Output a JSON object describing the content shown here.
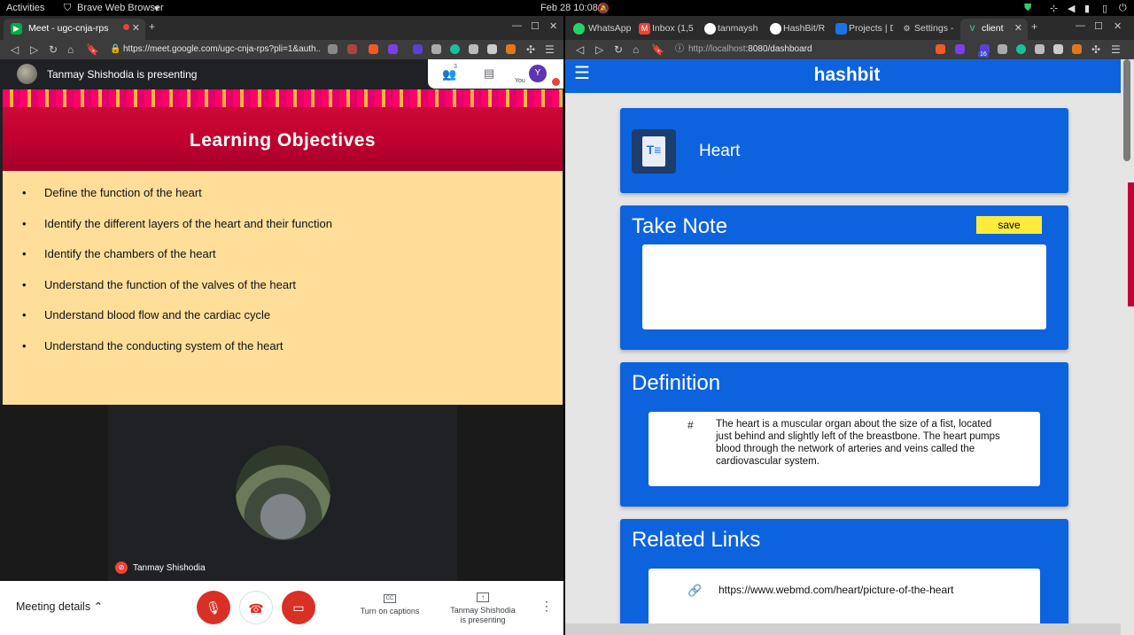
{
  "os": {
    "activities": "Activities",
    "app": "Brave Web Browser",
    "clock": "Feb 28  10:08"
  },
  "left_browser": {
    "tab_title": "Meet - ugc-cnja-rps",
    "url": "https://meet.google.com/ugc-cnja-rps?pli=1&auth...",
    "new_tab": "+"
  },
  "meet": {
    "presenting_label": "Tanmay Shishodia is presenting",
    "people_count": "3",
    "you_label": "You",
    "avatar_letter": "Y",
    "slide_title": "Learning Objectives",
    "slide_items": [
      "Define the function of the heart",
      "Identify the different layers of the heart and their function",
      "Identify the chambers of the heart",
      "Understand the function of the valves of the heart",
      "Understand blood flow and the cardiac cycle",
      "Understand the  conducting system of the heart"
    ],
    "participant_name": "Tanmay Shishodia",
    "meeting_details": "Meeting details",
    "captions_label": "Turn on captions",
    "presenting_line1": "Tanmay Shishodia",
    "presenting_line2": "is presenting"
  },
  "right_browser": {
    "tabs": [
      "WhatsApp",
      "Inbox (1,5",
      "tanmaysh",
      "HashBit/R",
      "Projects | D",
      "Settings - ",
      "client"
    ],
    "url_host": "http://localhost",
    "url_rest": ":8080/dashboard",
    "badge": "16"
  },
  "hashbit": {
    "brand": "hashbit",
    "topic": "Heart",
    "note_heading": "Take Note",
    "save_label": "save",
    "definition_heading": "Definition",
    "definition_marker": "#",
    "definition_text": "The heart is a muscular organ about the size of a fist, located just behind and slightly left of the breastbone. The heart pumps blood through the network of arteries and veins called the cardiovascular system.",
    "links_heading": "Related Links",
    "link1": "https://www.webmd.com/heart/picture-of-the-heart"
  },
  "colors": {
    "brand": "#0d63de",
    "save": "#ffeb3b",
    "slide_bg": "#ffde9a",
    "slide_head": "#c2002f"
  }
}
